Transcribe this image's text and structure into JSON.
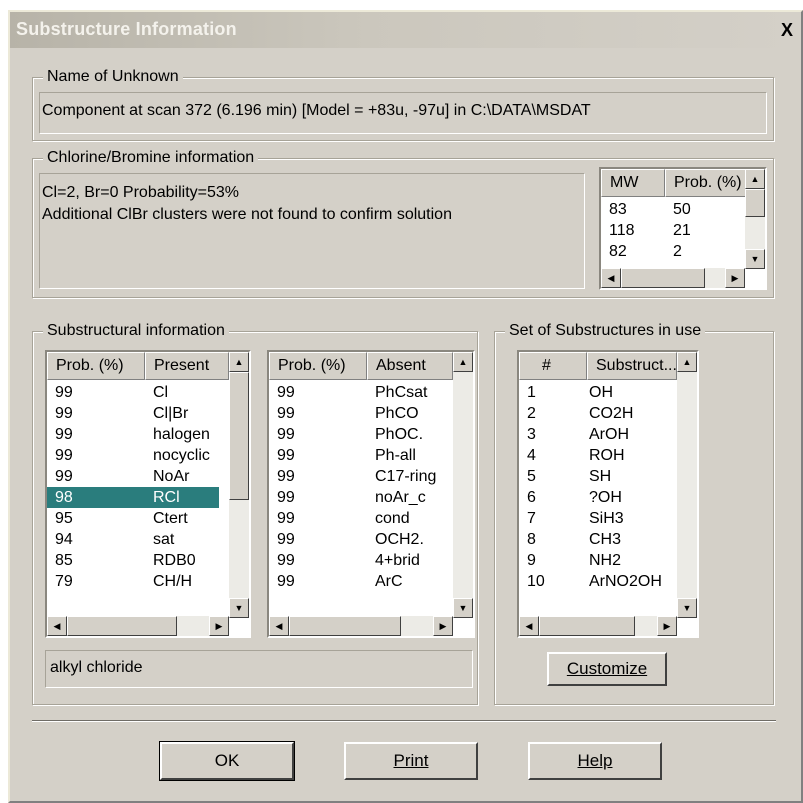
{
  "window": {
    "title": "Substructure Information",
    "close_label": "X"
  },
  "name_group": {
    "title": "Name of Unknown",
    "value": "Component at scan 372 (6.196 min) [Model = +83u, -97u] in C:\\DATA\\MSDAT"
  },
  "chlorine_group": {
    "title": "Chlorine/Bromine information",
    "line1": "Cl=2, Br=0 Probability=53%",
    "line2": "Additional ClBr clusters were not found to confirm solution"
  },
  "mw_list": {
    "columns": [
      "MW",
      "Prob. (%)"
    ],
    "rows": [
      [
        "83",
        "50"
      ],
      [
        "118",
        "21"
      ],
      [
        "82",
        "2"
      ]
    ]
  },
  "substructural_group": {
    "title": "Substructural information",
    "present_list": {
      "columns": [
        "Prob. (%)",
        "Present"
      ],
      "selected_index": 5,
      "rows": [
        [
          "99",
          "Cl"
        ],
        [
          "99",
          "Cl|Br"
        ],
        [
          "99",
          "halogen"
        ],
        [
          "99",
          "nocyclic"
        ],
        [
          "99",
          "NoAr"
        ],
        [
          "98",
          "RCl"
        ],
        [
          "95",
          "Ctert"
        ],
        [
          "94",
          "sat"
        ],
        [
          "85",
          "RDB0"
        ],
        [
          "79",
          "CH/H"
        ]
      ]
    },
    "absent_list": {
      "columns": [
        "Prob. (%)",
        "Absent"
      ],
      "rows": [
        [
          "99",
          "PhCsat"
        ],
        [
          "99",
          "PhCO"
        ],
        [
          "99",
          "PhOC."
        ],
        [
          "99",
          "Ph-all"
        ],
        [
          "99",
          "C17-ring"
        ],
        [
          "99",
          "noAr_c"
        ],
        [
          "99",
          "cond"
        ],
        [
          "99",
          "OCH2."
        ],
        [
          "99",
          "4+brid"
        ],
        [
          "99",
          "ArC"
        ]
      ]
    },
    "description": "alkyl chloride"
  },
  "set_group": {
    "title": "Set of Substructures in use",
    "list": {
      "columns": [
        "#",
        "Substruct..."
      ],
      "rows": [
        [
          "1",
          "OH"
        ],
        [
          "2",
          "CO2H"
        ],
        [
          "3",
          "ArOH"
        ],
        [
          "4",
          "ROH"
        ],
        [
          "5",
          "SH"
        ],
        [
          "6",
          "?OH"
        ],
        [
          "7",
          "SiH3"
        ],
        [
          "8",
          "CH3"
        ],
        [
          "9",
          "NH2"
        ],
        [
          "10",
          "ArNO2OH"
        ]
      ]
    },
    "customize_label": "Customize"
  },
  "buttons": {
    "ok": "OK",
    "print": "Print",
    "help": "Help"
  },
  "colors": {
    "dialog_bg": "#d4d0c8",
    "selection": "#2a7d7d"
  },
  "icons": {
    "scroll_up": "up-arrow-icon",
    "scroll_down": "down-arrow-icon",
    "scroll_left": "left-arrow-icon",
    "scroll_right": "right-arrow-icon"
  }
}
